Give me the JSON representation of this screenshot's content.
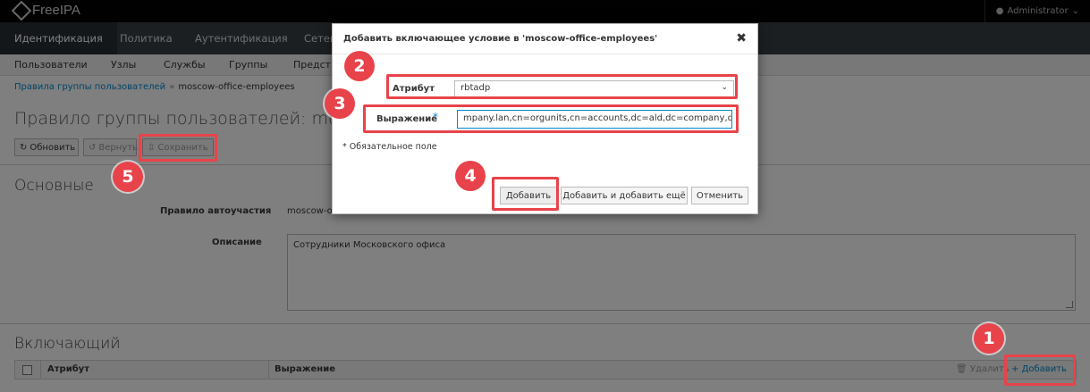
{
  "app": {
    "logo_text": "FreeIPA",
    "user": "Administrator"
  },
  "main_nav": [
    "Идентификация",
    "Политика",
    "Аутентификация",
    "Сетев"
  ],
  "sub_nav": [
    "Пользователи",
    "Узлы",
    "Службы",
    "Группы",
    "Предста"
  ],
  "breadcrumb": {
    "parent": "Правила группы пользователей",
    "separator": "»",
    "current": "moscow-office-employees"
  },
  "page": {
    "title": "Правило группы пользователей: moscow"
  },
  "toolbar": {
    "refresh": "Обновить",
    "revert": "Вернуть",
    "save": "Сохранить"
  },
  "general": {
    "section_title": "Основные",
    "rule_label": "Правило автоучастия",
    "rule_value": "moscow-o",
    "desc_label": "Описание",
    "desc_value": "Сотрудники Московского офиса"
  },
  "inclusive": {
    "section_title": "Включающий",
    "col_attribute": "Атрибут",
    "col_expression": "Выражение",
    "delete": "Удалить",
    "add": "Добавить"
  },
  "dialog": {
    "title": "Добавить включающее условие в 'moscow-office-employees'",
    "attribute_label": "Атрибут",
    "attribute_value": "rbtadp",
    "expression_label": "Выражение",
    "expression_value": "mpany.lan,cn=orgunits,cn=accounts,dc=ald,dc=company,dc=lan",
    "required_star": "*",
    "required_note": "* Обязательное поле",
    "btn_add": "Добавить",
    "btn_add_more": "Добавить и добавить ещё",
    "btn_cancel": "Отменить"
  },
  "badges": [
    "1",
    "2",
    "3",
    "4",
    "5"
  ],
  "colors": {
    "highlight": "#e8434a",
    "link": "#0088ce",
    "nav": "#393f44",
    "topbar": "#030303"
  }
}
